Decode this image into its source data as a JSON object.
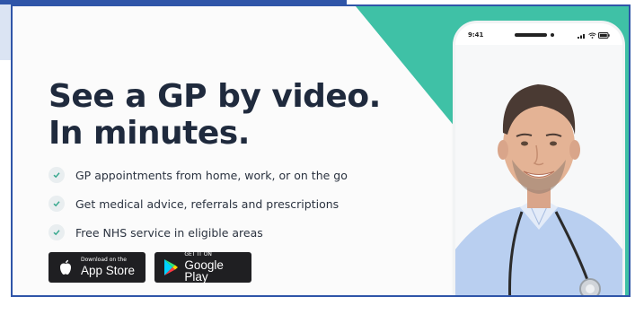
{
  "hero": {
    "headline_line1": "See a GP by video.",
    "headline_line2": "In minutes."
  },
  "features": [
    {
      "icon": "check-icon",
      "text": "GP appointments from home, work, or on the go"
    },
    {
      "icon": "check-icon",
      "text": "Get medical advice, referrals and prescriptions"
    },
    {
      "icon": "check-icon",
      "text": "Free NHS service in eligible areas"
    }
  ],
  "stores": {
    "app_store": {
      "icon": "apple-icon",
      "small": "Download on the",
      "big": "App Store"
    },
    "google_play": {
      "icon": "google-play-icon",
      "small": "GET IT ON",
      "big": "Google Play"
    }
  },
  "phone": {
    "time": "9:41",
    "status_icons": [
      "signal-icon",
      "wifi-icon",
      "battery-icon"
    ]
  },
  "colors": {
    "teal": "#3fc1a6",
    "headline": "#1f2a3d",
    "check": "#3aa98f",
    "store_button": "#1f1f22",
    "border": "#2f55a8"
  }
}
